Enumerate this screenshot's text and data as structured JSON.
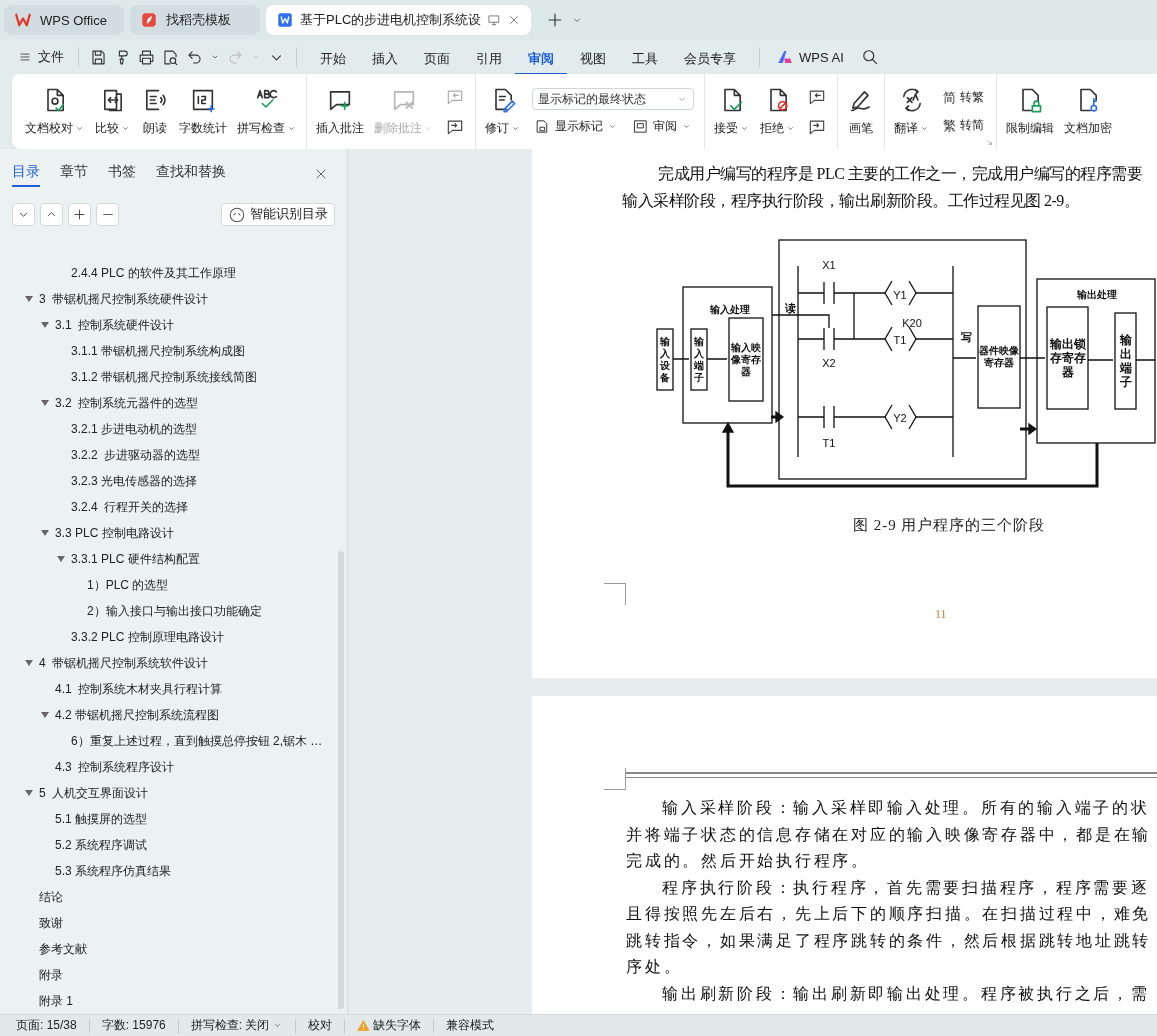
{
  "window_tabs": [
    {
      "label": "WPS Office",
      "selected": false
    },
    {
      "label": "找稻壳模板",
      "selected": false
    },
    {
      "label": "基于PLC的步进电机控制系统设",
      "selected": true
    }
  ],
  "menu_bar": {
    "file": "文件",
    "tabs": [
      {
        "label": "开始",
        "selected": false
      },
      {
        "label": "插入",
        "selected": false
      },
      {
        "label": "页面",
        "selected": false
      },
      {
        "label": "引用",
        "selected": false
      },
      {
        "label": "审阅",
        "selected": true
      },
      {
        "label": "视图",
        "selected": false
      },
      {
        "label": "工具",
        "selected": false
      },
      {
        "label": "会员专享",
        "selected": false
      }
    ],
    "ai": "WPS AI"
  },
  "ribbon": [
    {
      "items": [
        {
          "kind": "big",
          "label": "文档校对",
          "menu": true,
          "disabled": false
        },
        {
          "kind": "big",
          "label": "比较",
          "menu": true,
          "disabled": false
        },
        {
          "kind": "big",
          "label": "朗读",
          "menu": false,
          "disabled": false
        },
        {
          "kind": "big",
          "label": "字数统计",
          "menu": false,
          "disabled": false
        },
        {
          "kind": "big",
          "label": "拼写检查",
          "menu": true,
          "disabled": false
        }
      ]
    },
    {
      "items": [
        {
          "kind": "big",
          "label": "插入批注",
          "menu": false,
          "disabled": false
        },
        {
          "kind": "big",
          "label": "删除批注",
          "menu": true,
          "disabled": true
        },
        {
          "kind": "icon-stack"
        }
      ]
    },
    {
      "items": [
        {
          "kind": "big",
          "label": "修订",
          "menu": true,
          "disabled": false
        },
        {
          "kind": "display",
          "select": "显示标记的最终状态",
          "buttons": [
            {
              "label": "显示标记",
              "menu": true
            },
            {
              "label": "审阅",
              "menu": true
            }
          ]
        }
      ]
    },
    {
      "items": [
        {
          "kind": "big",
          "label": "接受",
          "menu": true,
          "disabled": false
        },
        {
          "kind": "big",
          "label": "拒绝",
          "menu": true,
          "disabled": false
        },
        {
          "kind": "icon-stack"
        }
      ]
    },
    {
      "items": [
        {
          "kind": "big",
          "label": "画笔",
          "menu": false,
          "disabled": false
        }
      ]
    },
    {
      "items": [
        {
          "kind": "big",
          "label": "翻译",
          "menu": true,
          "disabled": false
        },
        {
          "kind": "convert",
          "buttons": [
            {
              "glyph": "简",
              "label": "转繁"
            },
            {
              "glyph": "繁",
              "label": "转简"
            }
          ]
        }
      ]
    },
    {
      "items": [
        {
          "kind": "big",
          "label": "限制编辑",
          "menu": false,
          "disabled": false
        },
        {
          "kind": "big",
          "label": "文档加密",
          "menu": false,
          "disabled": false
        }
      ]
    }
  ],
  "sidebar": {
    "tabs": [
      {
        "label": "目录",
        "selected": true
      },
      {
        "label": "章节",
        "selected": false
      },
      {
        "label": "书签",
        "selected": false
      },
      {
        "label": "查找和替换",
        "selected": false
      }
    ],
    "smart_toc_button": "智能识别目录",
    "toc": [
      {
        "children": [
          {
            "children": [
              {
                "label": "2.4.4 PLC 的软件及其工作原理"
              }
            ]
          }
        ]
      },
      {
        "label": "3  带锯机摇尺控制系统硬件设计",
        "expanded": true,
        "children": [
          {
            "label": "3.1  控制系统硬件设计",
            "expanded": true,
            "children": [
              {
                "label": "3.1.1 带锯机摇尺控制系统构成图"
              },
              {
                "label": "3.1.2 带锯机摇尺控制系统接线简图"
              }
            ]
          },
          {
            "label": "3.2  控制系统元器件的选型",
            "expanded": true,
            "children": [
              {
                "label": "3.2.1 步进电动机的选型"
              },
              {
                "label": "3.2.2  步进驱动器的选型"
              },
              {
                "label": "3.2.3 光电传感器的选择"
              },
              {
                "label": "3.2.4  行程开关的选择"
              }
            ]
          },
          {
            "label": "3.3 PLC 控制电路设计",
            "expanded": true,
            "children": [
              {
                "label": "3.3.1 PLC 硬件结构配置",
                "expanded": true,
                "children": [
                  {
                    "label": "1）PLC 的选型"
                  },
                  {
                    "label": "2）输入接口与输出接口功能确定"
                  }
                ]
              },
              {
                "label": "3.3.2 PLC 控制原理电路设计"
              }
            ]
          }
        ]
      },
      {
        "label": "4  带锯机摇尺控制系统软件设计",
        "expanded": true,
        "children": [
          {
            "label": "4.1  控制系统木材夹具行程计算"
          },
          {
            "label": "4.2 带锯机摇尺控制系统流程图",
            "expanded": true,
            "children": [
              {
                "label": "6）重复上述过程，直到触摸总停按钮 2,锯木 …"
              }
            ]
          },
          {
            "label": "4.3  控制系统程序设计"
          }
        ]
      },
      {
        "label": "5  人机交互界面设计",
        "expanded": true,
        "children": [
          {
            "label": "5.1 触摸屏的选型"
          },
          {
            "label": "5.2 系统程序调试"
          },
          {
            "label": "5.3 系统程序仿真结果"
          }
        ]
      },
      {
        "label": "结论"
      },
      {
        "label": "致谢"
      },
      {
        "label": "参考文献"
      },
      {
        "label": "附录"
      },
      {
        "label": "附录 1"
      }
    ]
  },
  "document": {
    "pages": [
      {
        "lines": [
          {
            "text": "完成用户编写的程序是 PLC 主要的工作之一，完成用户编写的程序需要",
            "indent": true
          },
          {
            "text": "输入采样阶段，程序执行阶段，输出刷新阶段。工作过程见图 2-9。",
            "indent": false
          }
        ],
        "figure": {
          "blocks": [
            "输入设备",
            "输入端子",
            "输入映像寄存器",
            "器件映像寄存器",
            "输出锁存寄存器",
            "输出端子"
          ],
          "labels": [
            "输入处理",
            "读",
            "X1",
            "Y1",
            "K20",
            "T1",
            "X2",
            "Y2",
            "T1",
            "写",
            "输出处理"
          ]
        },
        "caption": "图 2-9 用户程序的三个阶段",
        "page_number": "11"
      },
      {
        "lines": [
          {
            "text": "输入采样阶段：输入采样即输入处理。所有的输入端子的状",
            "indent": true
          },
          {
            "text": "并将端子状态的信息存储在对应的输入映像寄存器中，都是在输",
            "indent": false
          },
          {
            "text": "完成的。然后开始执行程序。",
            "indent": false
          },
          {
            "text": "程序执行阶段：执行程序，首先需要扫描程序，程序需要逐",
            "indent": true
          },
          {
            "text": "且得按照先左后右，先上后下的顺序扫描。在扫描过程中，难免",
            "indent": false
          },
          {
            "text": "跳转指令，如果满足了程序跳转的条件，然后根据跳转地址跳转",
            "indent": false
          },
          {
            "text": "序处。",
            "indent": false
          },
          {
            "text": "输出刷新阶段：输出刷新即输出处理。程序被执行之后，需",
            "indent": true
          }
        ]
      }
    ]
  },
  "status_bar": [
    {
      "kind": "text",
      "text": "页面: 15/38",
      "menu": false
    },
    {
      "kind": "text",
      "text": "字数: 15976",
      "menu": false
    },
    {
      "kind": "text",
      "text": "拼写检查: 关闭",
      "menu": true
    },
    {
      "kind": "text",
      "text": "校对",
      "menu": false
    },
    {
      "kind": "warning",
      "text": "缺失字体",
      "menu": false
    },
    {
      "kind": "text",
      "text": "兼容模式",
      "menu": false
    }
  ]
}
